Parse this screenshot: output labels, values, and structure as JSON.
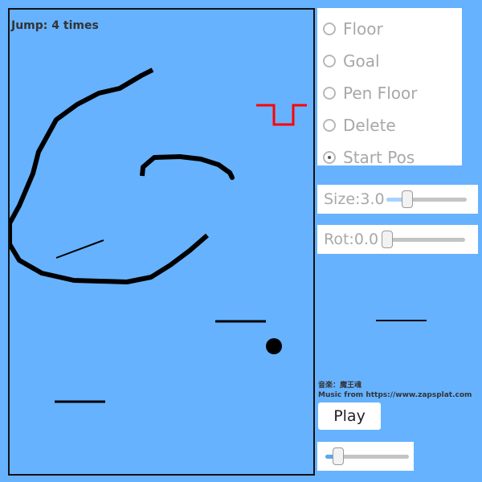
{
  "status": {
    "jump_text": "Jump: 4 times"
  },
  "modes": [
    {
      "label": "Floor",
      "selected": false
    },
    {
      "label": "Goal",
      "selected": false
    },
    {
      "label": "Pen Floor",
      "selected": false
    },
    {
      "label": "Delete",
      "selected": false
    },
    {
      "label": "Start Pos",
      "selected": true
    }
  ],
  "sliders": {
    "size": {
      "label": "Size:3.0",
      "value": 3.0
    },
    "rot": {
      "label": "Rot:0.0",
      "value": 0.0
    },
    "volume": {
      "value_fraction": 0.15
    }
  },
  "credits": {
    "music_jp": "音楽：魔王魂",
    "music_en": "Music from https://www.zapsplat.com"
  },
  "play_button": {
    "label": "Play"
  },
  "colors": {
    "background": "#66b2ff",
    "goal": "#ff0000",
    "pen": "#000000",
    "panel": "#ffffff",
    "slider_fill": "#a9d1ff"
  }
}
